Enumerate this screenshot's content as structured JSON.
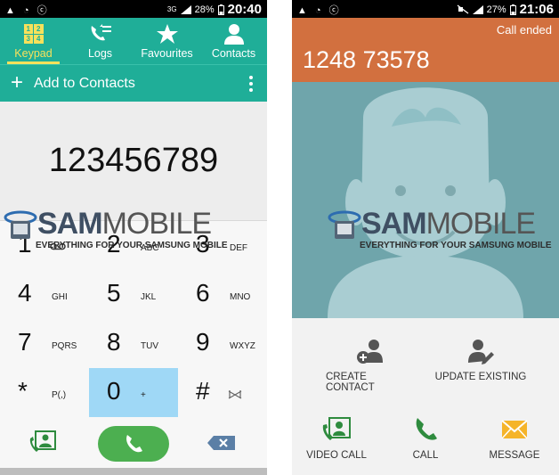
{
  "left_screen": {
    "status": {
      "notify_glyphs": "▲ ◔ ⓒ",
      "network": "3G",
      "battery": "28%",
      "time": "20:40"
    },
    "tabs": [
      {
        "label": "Keypad",
        "icon": "keypad-grid-icon",
        "active": true
      },
      {
        "label": "Logs",
        "icon": "call-log-icon"
      },
      {
        "label": "Favourites",
        "icon": "star-icon"
      },
      {
        "label": "Contacts",
        "icon": "person-icon"
      }
    ],
    "keypad_icon_digits": [
      "1",
      "2",
      "3",
      "4"
    ],
    "add_plus": "+",
    "add_to_contacts": "Add to Contacts",
    "dialed_number": "123456789",
    "keys": [
      {
        "digit": "1",
        "letters": ""
      },
      {
        "digit": "2",
        "letters": "ABC"
      },
      {
        "digit": "3",
        "letters": "DEF"
      },
      {
        "digit": "4",
        "letters": "GHI"
      },
      {
        "digit": "5",
        "letters": "JKL"
      },
      {
        "digit": "6",
        "letters": "MNO"
      },
      {
        "digit": "7",
        "letters": "PQRS"
      },
      {
        "digit": "8",
        "letters": "TUV"
      },
      {
        "digit": "9",
        "letters": "WXYZ"
      },
      {
        "digit": "*",
        "letters": "P(,)"
      },
      {
        "digit": "0",
        "letters": "+"
      },
      {
        "digit": "#",
        "letters": ""
      }
    ]
  },
  "right_screen": {
    "status": {
      "notify_glyphs": "▲ ◔ ⓒ",
      "battery": "27%",
      "time": "21:06"
    },
    "call_status": "Call ended",
    "phone_number": "1248 73578",
    "actions_top": [
      {
        "label": "CREATE CONTACT",
        "icon": "add-contact-icon"
      },
      {
        "label": "UPDATE EXISTING",
        "icon": "edit-contact-icon"
      }
    ],
    "actions_bottom": [
      {
        "label": "VIDEO CALL",
        "icon": "video-call-icon"
      },
      {
        "label": "CALL",
        "icon": "phone-icon"
      },
      {
        "label": "MESSAGE",
        "icon": "envelope-icon"
      }
    ]
  },
  "watermark": {
    "word_bold": "SAM",
    "word_light": "MOBILE",
    "tagline": "EVERYTHING FOR YOUR SAMSUNG MOBILE"
  },
  "colors": {
    "teal": "#1fae98",
    "highlight": "#f7e15b",
    "orange": "#d2703f",
    "photo_bg": "#6fa5ab",
    "green": "#4caf50",
    "key_highlight": "#9fd8f6"
  }
}
